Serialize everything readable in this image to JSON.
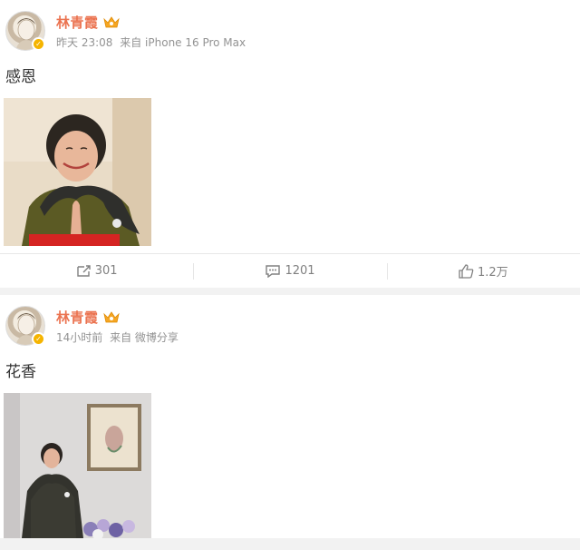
{
  "posts": [
    {
      "author": "林青霞",
      "time": "昨天 23:08",
      "source": "来自 iPhone 16 Pro Max",
      "text": "感恩",
      "image_icon": "photo-portrait",
      "actions": {
        "repost": "301",
        "comment": "1201",
        "like": "1.2万"
      }
    },
    {
      "author": "林青霞",
      "time": "14小时前",
      "source": "来自 微博分享",
      "text": "花香",
      "image_icon": "photo-portrait"
    }
  ],
  "colors": {
    "author": "#eb7350",
    "meta": "#939393",
    "verified": "#f5b400",
    "background": "#f2f2f2"
  }
}
